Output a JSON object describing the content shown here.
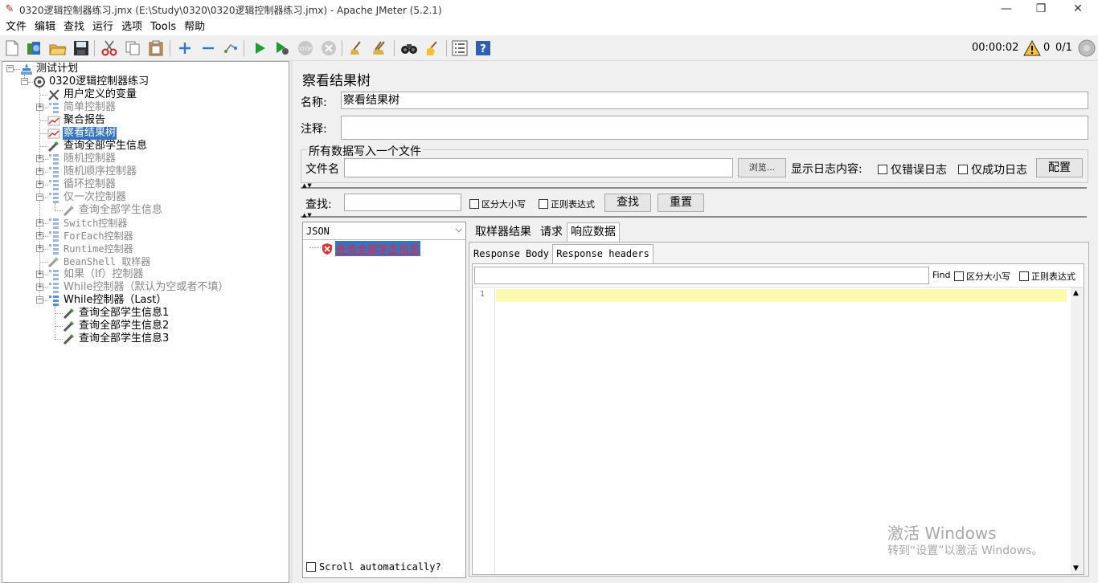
{
  "window": {
    "title": "0320逻辑控制器练习.jmx (E:\\Study\\0320\\0320逻辑控制器练习.jmx) - Apache JMeter (5.2.1)",
    "minimize": "—",
    "restore": "❐",
    "close": "✕"
  },
  "menu": [
    "文件",
    "编辑",
    "查找",
    "运行",
    "选项",
    "Tools",
    "帮助"
  ],
  "toolbar": {
    "timer": "00:00:02",
    "warning_count": "0",
    "threads": "0/1"
  },
  "tree": {
    "nodes": [
      {
        "label": "测试计划"
      },
      {
        "label": "0320逻辑控制器练习"
      },
      {
        "label": "用户定义的变量"
      },
      {
        "label": "简单控制器"
      },
      {
        "label": "聚合报告"
      },
      {
        "label": "察看结果树"
      },
      {
        "label": "查询全部学生信息"
      },
      {
        "label": "随机控制器"
      },
      {
        "label": "随机顺序控制器"
      },
      {
        "label": "循环控制器"
      },
      {
        "label": "仅一次控制器"
      },
      {
        "label": "查询全部学生信息"
      },
      {
        "label": "Switch控制器"
      },
      {
        "label": "ForEach控制器"
      },
      {
        "label": "Runtime控制器"
      },
      {
        "label": "BeanShell 取样器"
      },
      {
        "label": "如果（If）控制器"
      },
      {
        "label": "While控制器（默认为空或者不填）"
      },
      {
        "label": "While控制器（Last）"
      },
      {
        "label": "查询全部学生信息1"
      },
      {
        "label": "查询全部学生信息2"
      },
      {
        "label": "查询全部学生信息3"
      }
    ]
  },
  "panel": {
    "title": "察看结果树",
    "name_label": "名称:",
    "name_value": "察看结果树",
    "comment_label": "注释:",
    "comment_value": "",
    "file_group_title": "所有数据写入一个文件",
    "filename_label": "文件名",
    "filename_value": "",
    "browse_button": "浏览...",
    "log_label": "显示日志内容:",
    "errors_only": "仅错误日志",
    "success_only": "仅成功日志",
    "config_button": "配置",
    "search_label": "查找:",
    "search_value": "",
    "case_sensitive": "区分大小写",
    "regex": "正则表达式",
    "find_button": "查找",
    "reset_button": "重置"
  },
  "results": {
    "renderer": "JSON",
    "sample_label": "查询全部学生信息",
    "scroll_auto": "Scroll automatically?",
    "tabs": [
      "取样器结果",
      "请求",
      "响应数据"
    ],
    "active_tab": "响应数据",
    "subtabs": [
      "Response Body",
      "Response headers"
    ],
    "active_subtab": "Response headers",
    "find_label": "Find",
    "find_value": "",
    "find_case": "区分大小写",
    "find_regex": "正则表达式",
    "line_number": "1"
  },
  "watermark": {
    "line1": "激活 Windows",
    "line2": "转到“设置”以激活 Windows。"
  }
}
